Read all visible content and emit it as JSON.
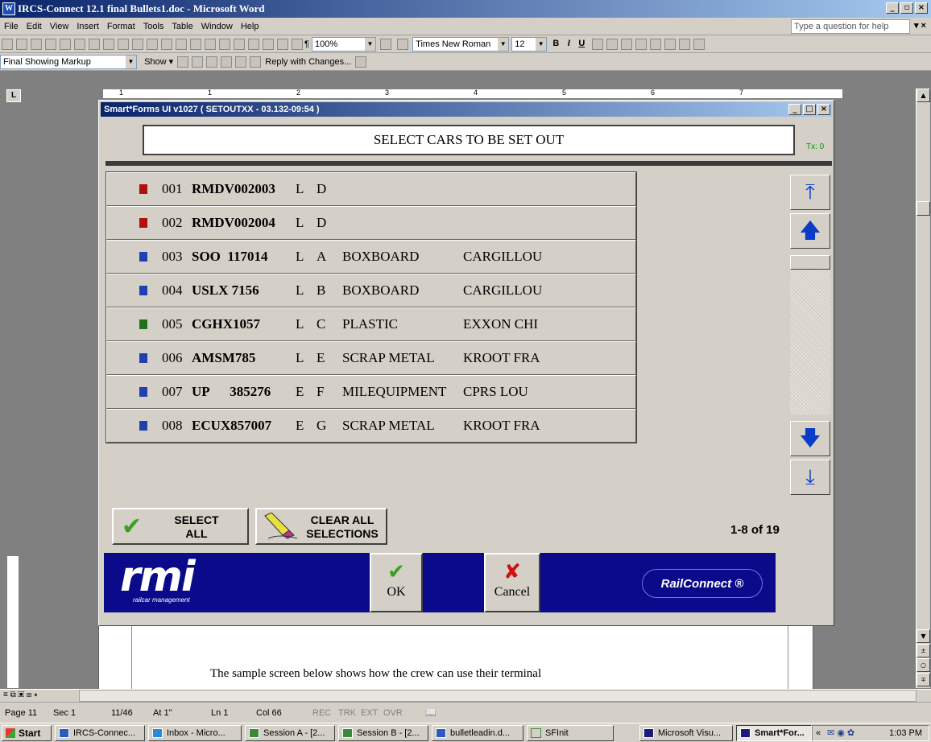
{
  "word": {
    "title": "IRCS-Connect 12.1 final Bullets1.doc - Microsoft Word",
    "menu": [
      "File",
      "Edit",
      "View",
      "Insert",
      "Format",
      "Tools",
      "Table",
      "Window",
      "Help"
    ],
    "help_placeholder": "Type a question for help",
    "zoom": "100%",
    "font": "Times New Roman",
    "font_size": "12",
    "markup_mode": "Final Showing Markup",
    "show_label": "Show",
    "reply_label": "Reply with Changes...",
    "ruler_numbers": [
      "1",
      "1",
      "2",
      "3",
      "4",
      "5",
      "6",
      "7"
    ]
  },
  "dialog": {
    "title": "Smart*Forms UI v1027 ( SETOUTXX - 03.132-09:54 )",
    "header": "SELECT CARS TO BE SET OUT",
    "tx": "Tx: 0",
    "rows": [
      {
        "num": "001",
        "car": "RMDV002003",
        "le": "L",
        "status": "D",
        "commodity": "",
        "consignee": "",
        "icon_color": "#b01010"
      },
      {
        "num": "002",
        "car": "RMDV002004",
        "le": "L",
        "status": "D",
        "commodity": "",
        "consignee": "",
        "icon_color": "#b01010"
      },
      {
        "num": "003",
        "car": "SOO  117014",
        "le": "L",
        "status": "A",
        "commodity": "BOXBOARD",
        "consignee": "CARGILLOU",
        "icon_color": "#2040b0"
      },
      {
        "num": "004",
        "car": "USLX 7156",
        "le": "L",
        "status": "B",
        "commodity": "BOXBOARD",
        "consignee": "CARGILLOU",
        "icon_color": "#2040b0"
      },
      {
        "num": "005",
        "car": "CGHX1057",
        "le": "L",
        "status": "C",
        "commodity": "PLASTIC",
        "consignee": "EXXON CHI",
        "icon_color": "#207020"
      },
      {
        "num": "006",
        "car": "AMSM785",
        "le": "L",
        "status": "E",
        "commodity": "SCRAP METAL",
        "consignee": "KROOT FRA",
        "icon_color": "#2040b0"
      },
      {
        "num": "007",
        "car": "UP      385276",
        "le": "E",
        "status": "F",
        "commodity": "MILEQUIPMENT",
        "consignee": "CPRS LOU",
        "icon_color": "#2040b0"
      },
      {
        "num": "008",
        "car": "ECUX857007",
        "le": "E",
        "status": "G",
        "commodity": "SCRAP METAL",
        "consignee": "KROOT FRA",
        "icon_color": "#2040b0"
      }
    ],
    "select_all": [
      "SELECT",
      "ALL"
    ],
    "clear_all": [
      "CLEAR ALL",
      "SELECTIONS"
    ],
    "count": "1-8 of 19",
    "ok_label": "OK",
    "cancel_label": "Cancel",
    "rmi_logo": "rmi",
    "rmi_sub": "railcar management",
    "railconnect": "RailConnect ®"
  },
  "doc": {
    "text": "The sample screen below shows how the crew can use their terminal"
  },
  "status": {
    "page": "Page 11",
    "sec": "Sec 1",
    "pos": "11/46",
    "at": "At 1\"",
    "ln": "Ln 1",
    "col": "Col 66",
    "modes": [
      "REC",
      "TRK",
      "EXT",
      "OVR"
    ]
  },
  "taskbar": {
    "start": "Start",
    "tasks": [
      "IRCS-Connec...",
      "Inbox - Micro...",
      "Session A - [2...",
      "Session B - [2...",
      "bulletleadin.d...",
      "SFInit",
      "Microsoft Visu...",
      "Smart*For..."
    ],
    "time": "1:03 PM"
  }
}
